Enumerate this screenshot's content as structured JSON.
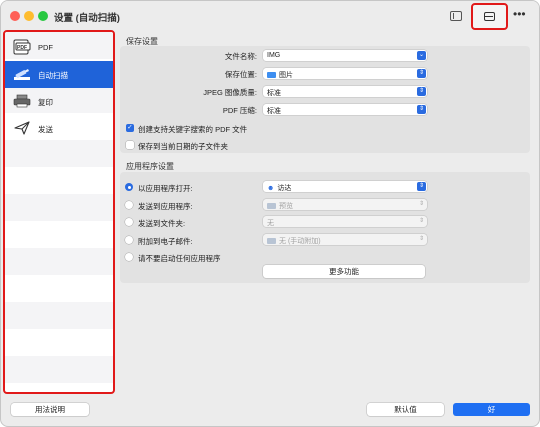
{
  "window": {
    "title": "设置 (自动扫描)"
  },
  "toolbar": {
    "sidebar_icon": "sidebar-toggle-icon",
    "scanner_icon": "scanner-icon",
    "more_label": "•••"
  },
  "sidebar": {
    "items": [
      {
        "label": "PDF",
        "icon": "pdf-icon"
      },
      {
        "label": "自动扫描",
        "icon": "scanner-auto-icon",
        "active": true
      },
      {
        "label": "复印",
        "icon": "printer-icon"
      },
      {
        "label": "发送",
        "icon": "paper-plane-icon"
      }
    ]
  },
  "save_settings": {
    "header": "保存设置",
    "file_name": {
      "label": "文件名称:",
      "value": "IMG"
    },
    "save_location": {
      "label": "保存位置:",
      "value": "图片"
    },
    "jpeg_quality": {
      "label": "JPEG 图像质量:",
      "value": "标准"
    },
    "pdf_compression": {
      "label": "PDF 压缩:",
      "value": "标准"
    },
    "checkbox_searchable_pdf": {
      "label": "创建支持关键字搜索的 PDF 文件",
      "checked": true
    },
    "checkbox_date_subfolder": {
      "label": "保存到当前日期的子文件夹",
      "checked": false
    }
  },
  "app_settings": {
    "header": "应用程序设置",
    "options": [
      {
        "label": "以应用程序打开:",
        "value": "访达",
        "selected": true,
        "enabled": true
      },
      {
        "label": "发送到应用程序:",
        "value": "预览",
        "selected": false,
        "enabled": false
      },
      {
        "label": "发送到文件夹:",
        "value": "无",
        "selected": false,
        "enabled": false
      },
      {
        "label": "附加到电子邮件:",
        "value": "无 (手动附加)",
        "selected": false,
        "enabled": false
      },
      {
        "label": "请不要启动任何应用程序",
        "selected": false
      }
    ],
    "more_functions": "更多功能"
  },
  "footer": {
    "help": "用法说明",
    "defaults": "默认值",
    "ok": "好"
  },
  "colors": {
    "accent": "#1f63d9",
    "highlight_border": "#e11919"
  }
}
